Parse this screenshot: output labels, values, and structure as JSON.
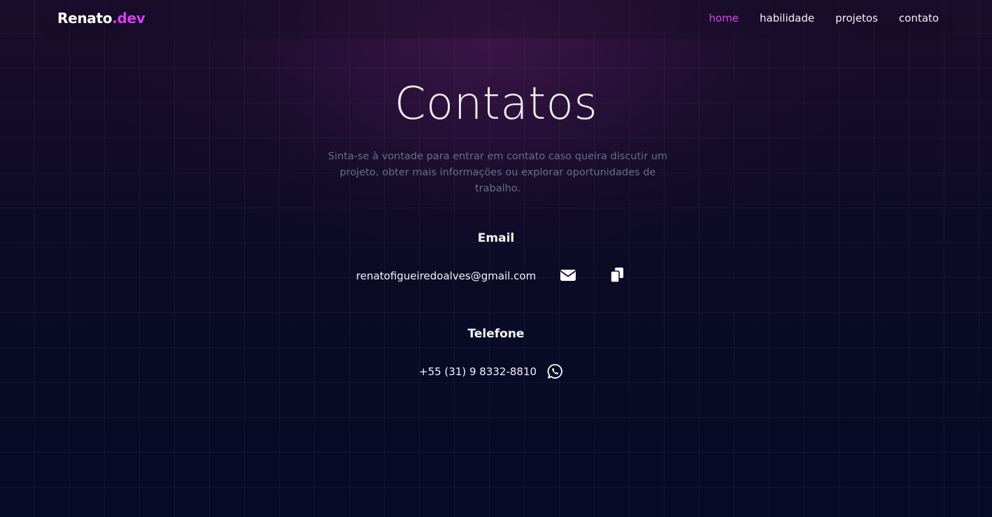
{
  "brand": {
    "name": "Renato",
    "suffix": ".dev",
    "accent_color": "#d63ff0"
  },
  "nav": {
    "items": [
      {
        "label": "home",
        "active": true
      },
      {
        "label": "habilidade",
        "active": false
      },
      {
        "label": "projetos",
        "active": false
      },
      {
        "label": "contato",
        "active": false
      }
    ],
    "active_color": "#d04ae8"
  },
  "contact": {
    "title": "Contatos",
    "subtitle": "Sinta-se à vontade para entrar em contato caso queira discutir um projeto, obter mais informações ou explorar oportunidades de trabalho.",
    "email": {
      "label": "Email",
      "value": "renatofigueiredoalves@gmail.com",
      "icons": [
        "envelope-icon",
        "copy-icon"
      ]
    },
    "phone": {
      "label": "Telefone",
      "value": "+55 (31) 9 8332-8810",
      "icons": [
        "whatsapp-icon"
      ]
    }
  }
}
